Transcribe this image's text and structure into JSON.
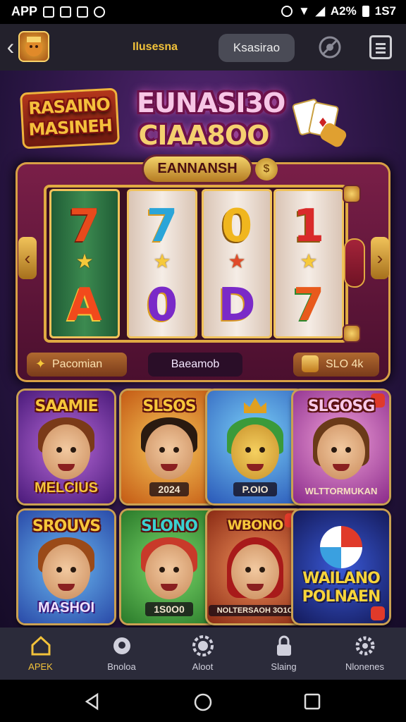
{
  "status_bar": {
    "left_label": "APP",
    "right_text": "A2%",
    "time": "1S7"
  },
  "header": {
    "title": "Ilusesna",
    "button_label": "Ksasirao"
  },
  "signs": {
    "left_line1": "RASAINO",
    "left_line2": "MASINEH",
    "main_line1": "EUNASI3O",
    "main_line2": "CIAA8OO"
  },
  "machine": {
    "banner": "EANNANSH",
    "reels": [
      {
        "top": "7",
        "bottom": "A"
      },
      {
        "top": "7",
        "bottom": "0"
      },
      {
        "top": "0",
        "bottom": "D"
      },
      {
        "top": "1",
        "bottom": "7"
      }
    ],
    "button_left": "Pacomian",
    "button_mid": "Baeamob",
    "button_right": "SLO 4k"
  },
  "games": [
    {
      "title": "SAAMIE",
      "bottom": "MELCIUS"
    },
    {
      "title": "SLSOS",
      "bottom": "2024"
    },
    {
      "title": "",
      "bottom": "P.OIO"
    },
    {
      "title": "SLGOSG",
      "bottom": "WLTTORMUKAN"
    },
    {
      "title": "SROUVS",
      "bottom": "MASHOI"
    },
    {
      "title": "SLONO",
      "bottom": "1S0O0"
    },
    {
      "title": "WBONO",
      "bottom": "NOLTERSAOH 3O1O"
    },
    {
      "title": "WAILANO POLNAEN",
      "bottom": ""
    }
  ],
  "nav": [
    {
      "label": "APEK",
      "icon": "home-icon"
    },
    {
      "label": "Bnoloa",
      "icon": "search-icon"
    },
    {
      "label": "Aloot",
      "icon": "gear-icon"
    },
    {
      "label": "Slaing",
      "icon": "lock-icon"
    },
    {
      "label": "Nlonenes",
      "icon": "settings-icon"
    }
  ],
  "colors": {
    "accent": "#f2c23a",
    "header_bg": "#23212c",
    "nav_bg": "#2b2b3a",
    "nav_active": "#f2c23a"
  }
}
